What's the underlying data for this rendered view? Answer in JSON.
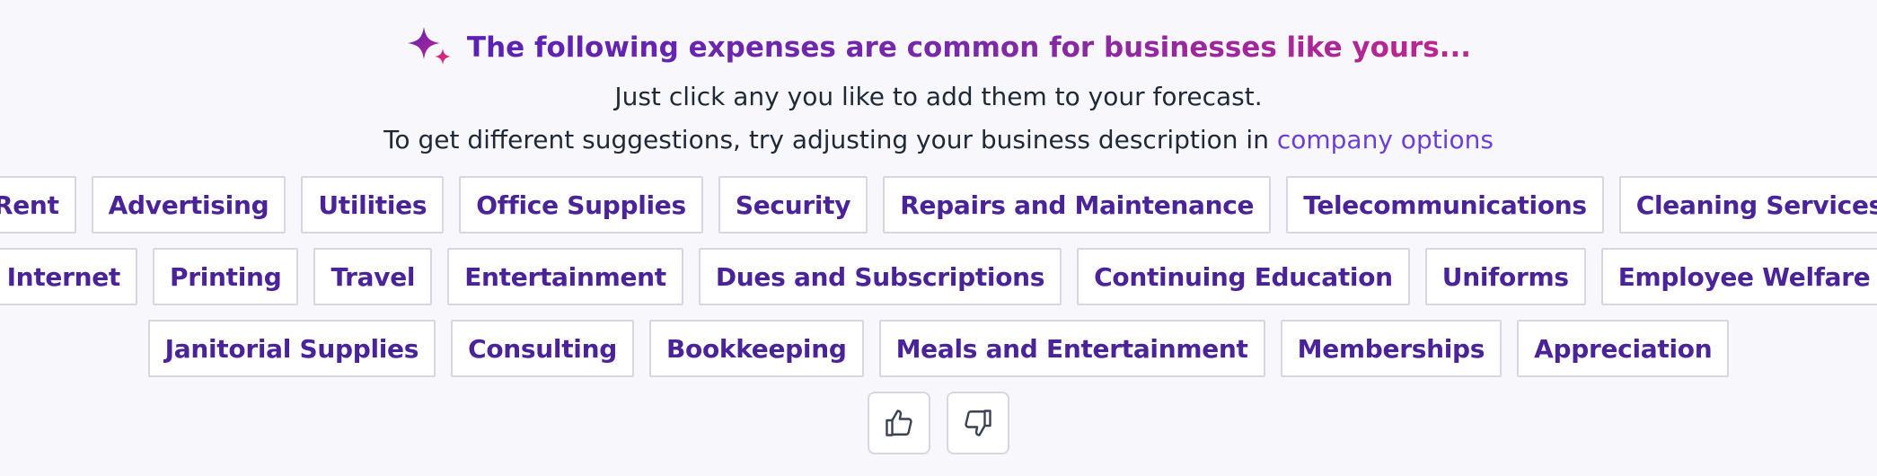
{
  "header": {
    "title": "The following expenses are common for businesses like yours...",
    "icon": "sparkle-icon"
  },
  "instructions": {
    "line1": "Just click any you like to add them to your forecast.",
    "line2_prefix": "To get different suggestions, try adjusting your business description in",
    "line2_link": "company options"
  },
  "suggestions": {
    "row1": [
      "Rent",
      "Advertising",
      "Utilities",
      "Office Supplies",
      "Security",
      "Repairs and Maintenance",
      "Telecommunications",
      "Cleaning Services"
    ],
    "row2": [
      "Internet",
      "Printing",
      "Travel",
      "Entertainment",
      "Dues and Subscriptions",
      "Continuing Education",
      "Uniforms",
      "Employee Welfare"
    ],
    "row3": [
      "Janitorial Supplies",
      "Consulting",
      "Bookkeeping",
      "Meals and Entertainment",
      "Memberships",
      "Appreciation"
    ]
  },
  "feedback": {
    "like_icon": "thumbs-up-icon",
    "dislike_icon": "thumbs-down-icon"
  },
  "colors": {
    "chip_text": "#4a2398",
    "link": "#6d3fd9",
    "title_gradient_start": "#5b21b6",
    "title_gradient_end": "#c0268f"
  }
}
